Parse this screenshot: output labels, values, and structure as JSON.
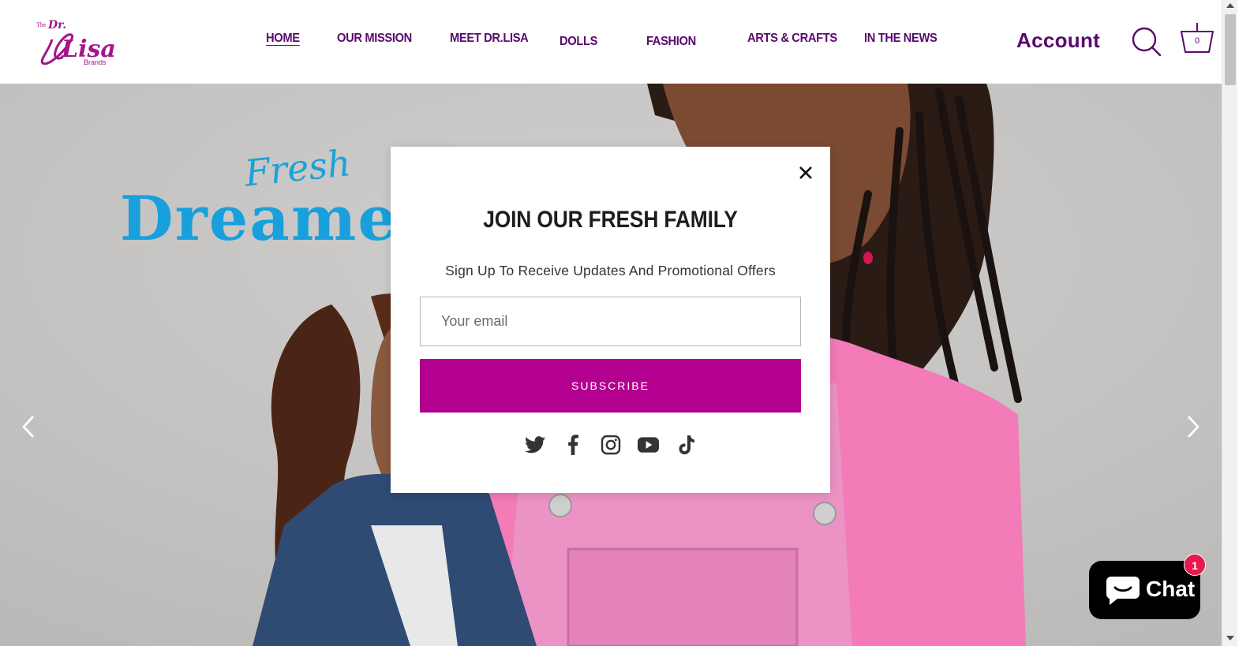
{
  "brand": {
    "logo_line1": "The",
    "logo_line2": "Dr.",
    "logo_line3": "Lisa",
    "logo_line4": "Brands",
    "color": "#a3168a"
  },
  "nav": {
    "items": [
      {
        "label": "HOME",
        "active": true
      },
      {
        "label": "OUR MISSION"
      },
      {
        "label": "MEET DR.LISA"
      },
      {
        "label": "DOLLS"
      },
      {
        "label": "FASHION"
      },
      {
        "label": "ARTS & CRAFTS"
      },
      {
        "label": "IN THE NEWS"
      }
    ],
    "color": "#5a0a6e"
  },
  "header": {
    "account_label": "Account",
    "search_icon": "search-icon",
    "cart_icon": "basket-icon",
    "cart_count": "0"
  },
  "hero": {
    "fresh_text": "Fresh",
    "dreamers_text": "Dreamers",
    "accent": "#19a0dc"
  },
  "popup": {
    "title": "JOIN OUR FRESH FAMILY",
    "subtitle": "Sign Up To Receive Updates And Promotional Offers",
    "email_placeholder": "Your email",
    "button_label": "SUBSCRIBE",
    "button_color": "#b3008f",
    "close_icon": "close-icon",
    "socials": [
      "twitter-icon",
      "facebook-icon",
      "instagram-icon",
      "youtube-icon",
      "tiktok-icon"
    ]
  },
  "chat": {
    "label": "Chat",
    "badge": "1",
    "badge_color": "#e8194b"
  }
}
